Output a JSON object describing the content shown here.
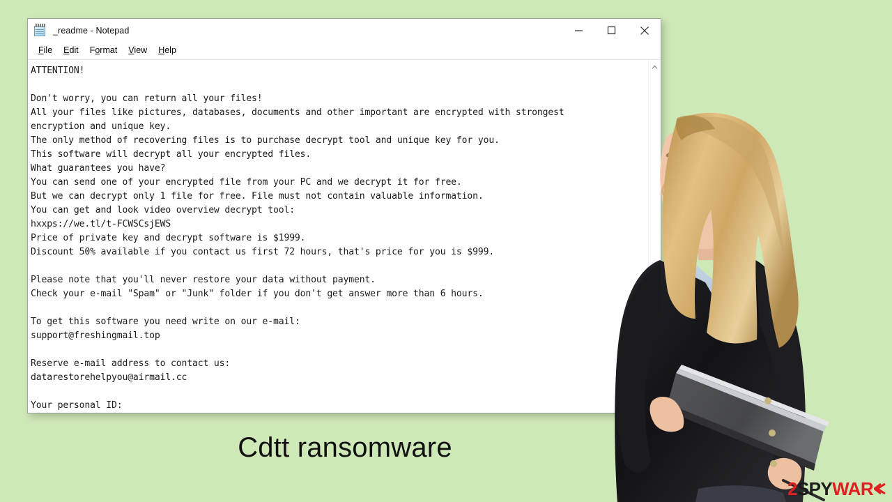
{
  "window": {
    "title": "_readme - Notepad",
    "icon": "notepad-icon",
    "controls": {
      "minimize": "minimize-icon",
      "maximize": "maximize-icon",
      "close": "close-icon"
    },
    "menu": [
      {
        "label": "File",
        "accesskey": "F"
      },
      {
        "label": "Edit",
        "accesskey": "E"
      },
      {
        "label": "Format",
        "accesskey": "o"
      },
      {
        "label": "View",
        "accesskey": "V"
      },
      {
        "label": "Help",
        "accesskey": "H"
      }
    ],
    "scrollbar": {
      "up_arrow": "chevron-up-icon"
    }
  },
  "note": {
    "body": "ATTENTION!\n\nDon't worry, you can return all your files!\nAll your files like pictures, databases, documents and other important are encrypted with strongest\nencryption and unique key.\nThe only method of recovering files is to purchase decrypt tool and unique key for you.\nThis software will decrypt all your encrypted files.\nWhat guarantees you have?\nYou can send one of your encrypted file from your PC and we decrypt it for free.\nBut we can decrypt only 1 file for free. File must not contain valuable information.\nYou can get and look video overview decrypt tool:\nhxxps://we.tl/t-FCWSCsjEWS\nPrice of private key and decrypt software is $1999.\nDiscount 50% available if you contact us first 72 hours, that's price for you is $999.\n\nPlease note that you'll never restore your data without payment.\nCheck your e-mail \"Spam\" or \"Junk\" folder if you don't get answer more than 6 hours.\n\nTo get this software you need write on our e-mail:\nsupport@freshingmail.top\n\nReserve e-mail address to contact us:\ndatarestorehelpyou@airmail.cc\n\nYour personal ID:",
    "url": "hxxps://we.tl/t-FCWSCsjEWS",
    "price_full": "$1999",
    "price_discount": "$999",
    "discount_percent": "50%",
    "discount_window_hours": "72",
    "answer_hours": "6",
    "email_primary": "support@freshingmail.top",
    "email_reserve": "datarestorehelpyou@airmail.cc"
  },
  "caption": {
    "text": "Cdtt ransomware"
  },
  "logo": {
    "digit": "2",
    "part_dark": "SPY",
    "part_red": "WAR",
    "mark": "chevron-double-left-icon"
  },
  "colors": {
    "background": "#cfe8b8",
    "window_bg": "#ffffff",
    "text": "#1b1b1b",
    "caption": "#111111",
    "logo_red": "#e02020",
    "logo_dark": "#1c1c1c"
  }
}
